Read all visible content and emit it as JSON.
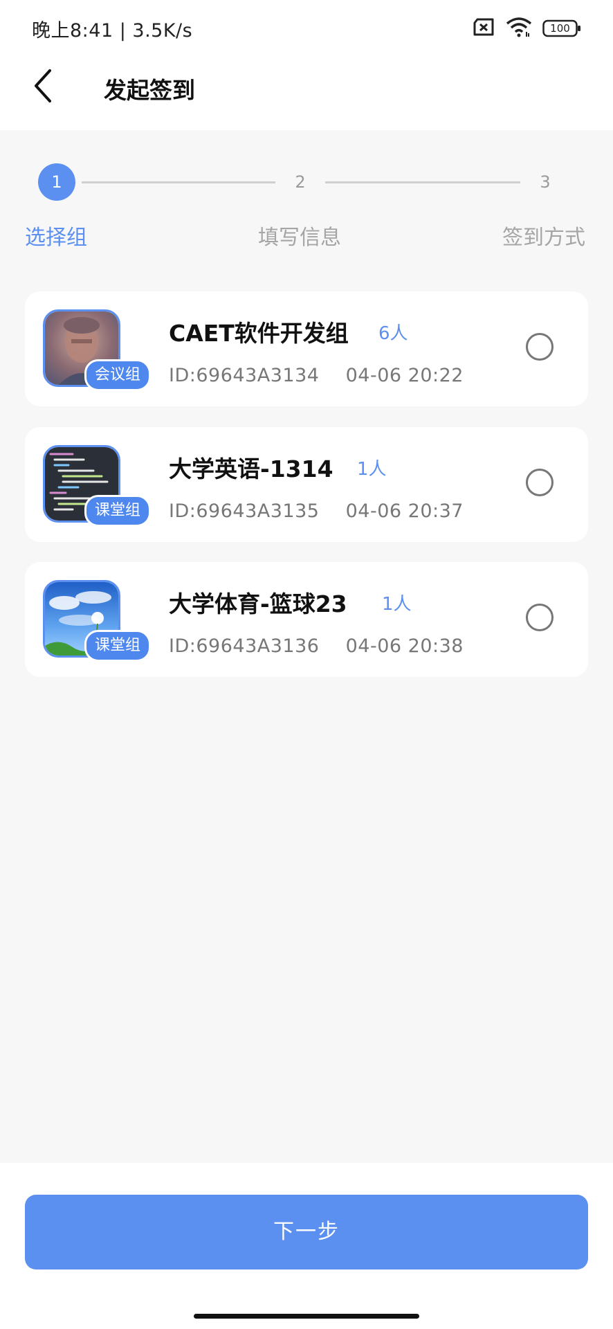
{
  "status_bar": {
    "time": "晚上8:41 | 3.5K/s",
    "battery": "100"
  },
  "header": {
    "title": "发起签到"
  },
  "stepper": {
    "steps": [
      {
        "number": "1",
        "label": "选择组",
        "active": true
      },
      {
        "number": "2",
        "label": "填写信息",
        "active": false
      },
      {
        "number": "3",
        "label": "签到方式",
        "active": false
      }
    ]
  },
  "groups": [
    {
      "name": "CAET软件开发组",
      "count": "6人",
      "badge": "会议组",
      "id": "ID:69643A3134",
      "date": "04-06 20:22",
      "image": "portrait-photo"
    },
    {
      "name": "大学英语-1314",
      "count": "1人",
      "badge": "课堂组",
      "id": "ID:69643A3135",
      "date": "04-06 20:37",
      "image": "code-screenshot"
    },
    {
      "name": "大学体育-篮球23",
      "count": "1人",
      "badge": "课堂组",
      "id": "ID:69643A3136",
      "date": "04-06 20:38",
      "image": "sky-dandelion"
    }
  ],
  "footer": {
    "next_label": "下一步"
  },
  "colors": {
    "accent": "#5b8ff0",
    "background": "#f7f7f7"
  }
}
